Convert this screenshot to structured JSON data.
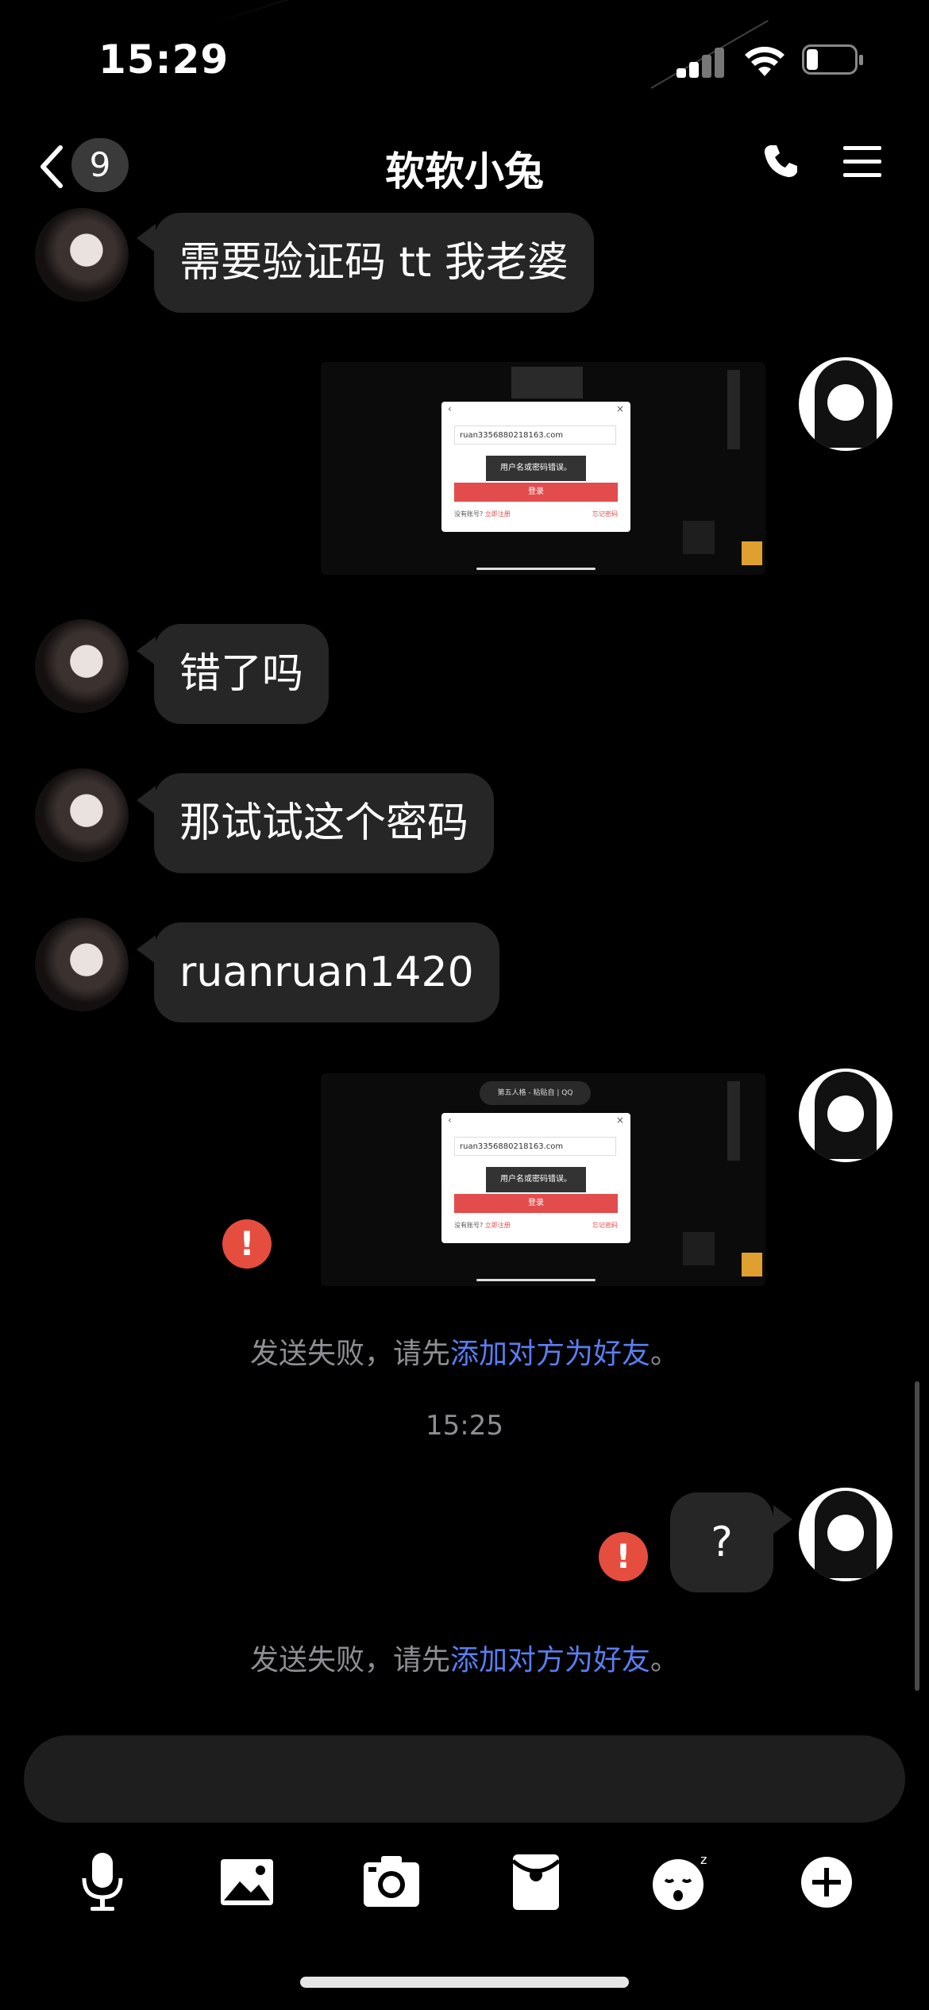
{
  "status_bar": {
    "time": "15:29"
  },
  "header": {
    "unread_count": "9",
    "title": "软软小兔"
  },
  "messages": [
    {
      "text": "需要验证码 tt 我老婆"
    },
    {
      "text": "错了吗"
    },
    {
      "text": "那试试这个密码"
    },
    {
      "text": "ruanruan1420"
    },
    {
      "text": "?"
    }
  ],
  "screenshot_image": {
    "email": "ruan3356880218163.com",
    "toast": "用户名或密码错误。",
    "login_button": "登录",
    "no_account": "没有账号?",
    "register": "立即注册",
    "forgot": "忘记密码",
    "pill": "第五人格 - 粘贴自 | QQ"
  },
  "send_failed": {
    "prefix": "发送失败，请先",
    "link": "添加对方为好友",
    "suffix": "。"
  },
  "time_divider": "15:25",
  "input": {
    "placeholder": ""
  },
  "colors": {
    "background": "#000000",
    "bubble": "#262626",
    "link": "#5a7ef0",
    "error": "#e54d3e"
  },
  "icons": [
    "back-icon",
    "phone-icon",
    "menu-icon",
    "microphone-icon",
    "image-icon",
    "camera-icon",
    "red-packet-icon",
    "sticker-icon",
    "plus-icon"
  ]
}
